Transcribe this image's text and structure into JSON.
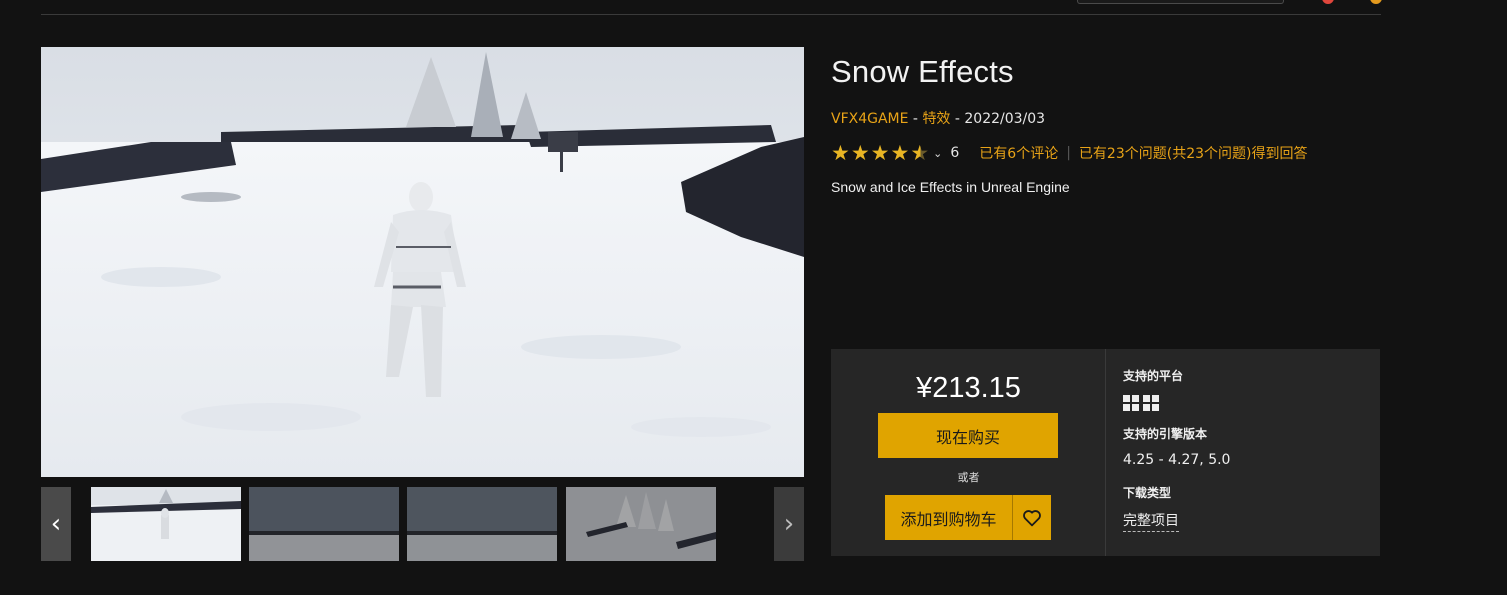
{
  "product": {
    "title": "Snow Effects",
    "seller": "VFX4GAME",
    "dash1": " - ",
    "category": "特效",
    "dash2": " - ",
    "date": "2022/03/03",
    "rating": 4.5,
    "rating_count": "6",
    "reviews_link": "已有6个评论",
    "questions_link": "已有23个问题(共23个问题)得到回答",
    "description": "Snow and Ice Effects in Unreal Engine"
  },
  "purchase": {
    "price": "¥213.15",
    "buy_now_label": "现在购买",
    "or_label": "或者",
    "add_to_cart_label": "添加到购物车"
  },
  "details": {
    "platforms_label": "支持的平台",
    "platforms": [
      "windows-icon",
      "windows-icon"
    ],
    "engine_label": "支持的引擎版本",
    "engine_versions": "4.25 - 4.27, 5.0",
    "download_label": "下载类型",
    "download_type": "完整项目"
  },
  "carousel": {
    "prev_icon": "chevron-left-icon",
    "next_icon": "chevron-right-icon",
    "thumbnails": [
      "snow-scene-character",
      "snow-horizon-1",
      "snow-horizon-2",
      "snow-trees-scene"
    ],
    "selected_index": 0
  },
  "colors": {
    "accent": "#e0a400",
    "link": "#e8a317",
    "background": "#121212",
    "panel": "#262626"
  }
}
